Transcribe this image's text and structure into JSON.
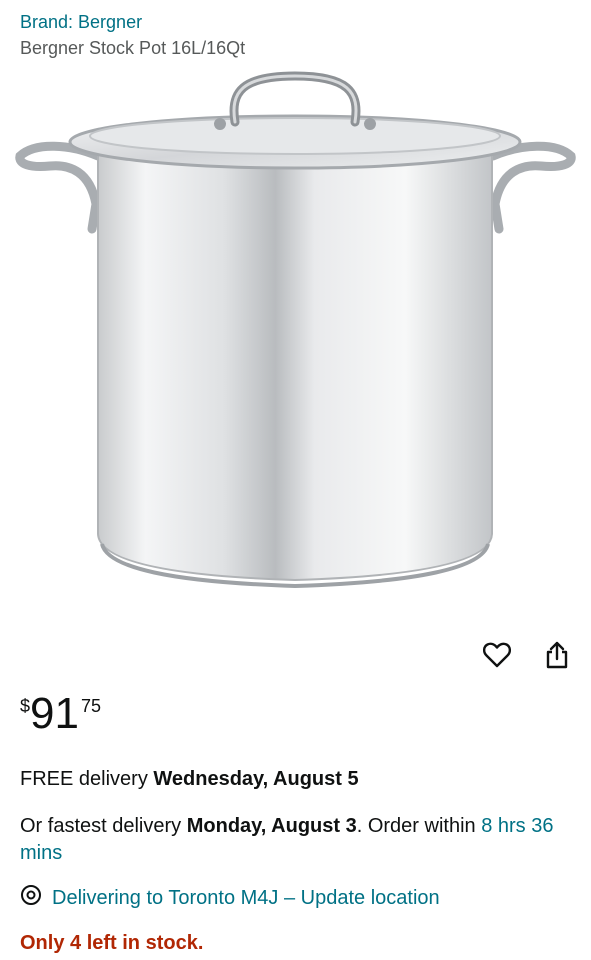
{
  "brand": {
    "label": "Brand: Bergner"
  },
  "product": {
    "title": "Bergner Stock Pot 16L/16Qt"
  },
  "price": {
    "symbol": "$",
    "whole": "91",
    "fraction": "75"
  },
  "delivery": {
    "prefix": "FREE delivery ",
    "date": "Wednesday, August 5"
  },
  "fastest": {
    "prefix": "Or fastest delivery ",
    "date": "Monday, August 3",
    "middle": ". Order within ",
    "countdown": "8 hrs 36 mins"
  },
  "location": {
    "label": "Delivering to Toronto M4J – Update location"
  },
  "stock": {
    "label": "Only 4 left in stock."
  },
  "icons": {
    "wishlist": "heart-icon",
    "share": "share-icon",
    "location": "location-pin-icon"
  },
  "colors": {
    "link": "#007185",
    "stock_alert": "#b12704",
    "text": "#0f1111",
    "muted": "#565959"
  }
}
